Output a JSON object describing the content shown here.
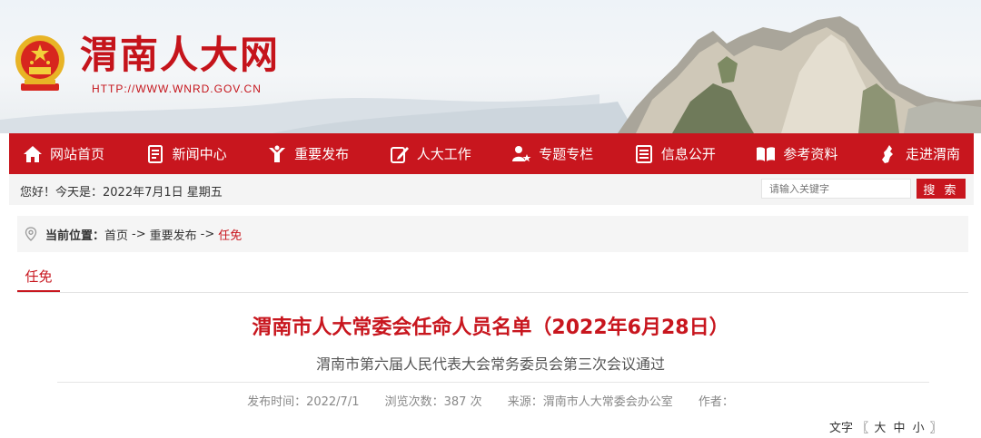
{
  "header": {
    "site_title": "渭南人大网",
    "site_url": "HTTP://WWW.WNRD.GOV.CN",
    "colors": {
      "brand_red": "#c8161e"
    }
  },
  "nav": {
    "items": [
      {
        "label": "网站首页",
        "icon": "home-icon"
      },
      {
        "label": "新闻中心",
        "icon": "document-icon"
      },
      {
        "label": "重要发布",
        "icon": "megaphone-icon"
      },
      {
        "label": "人大工作",
        "icon": "edit-icon"
      },
      {
        "label": "专题专栏",
        "icon": "person-star-icon"
      },
      {
        "label": "信息公开",
        "icon": "list-icon"
      },
      {
        "label": "参考资料",
        "icon": "book-icon"
      },
      {
        "label": "走进渭南",
        "icon": "map-icon"
      }
    ]
  },
  "topbar": {
    "greeting": "您好！今天是：2022年7月1日 星期五",
    "search_placeholder": "请输入关键字",
    "search_button": "搜 索"
  },
  "breadcrumb": {
    "label": "当前位置：",
    "items": [
      "首页",
      "重要发布"
    ],
    "separator": "->",
    "current": "任免"
  },
  "tab": {
    "label": "任免"
  },
  "article": {
    "title": "渭南市人大常委会任命人员名单（2022年6月28日）",
    "subtitle": "渭南市第六届人民代表大会常务委员会第三次会议通过",
    "publish_time": "发布时间：2022/7/1",
    "views": "浏览次数：387 次",
    "source": "来源：渭南市人大常委会办公室",
    "author": "作者："
  },
  "fontsize": {
    "label": "文字",
    "open": "〖",
    "large": "大",
    "medium": "中",
    "small": "小",
    "close": "〗"
  }
}
